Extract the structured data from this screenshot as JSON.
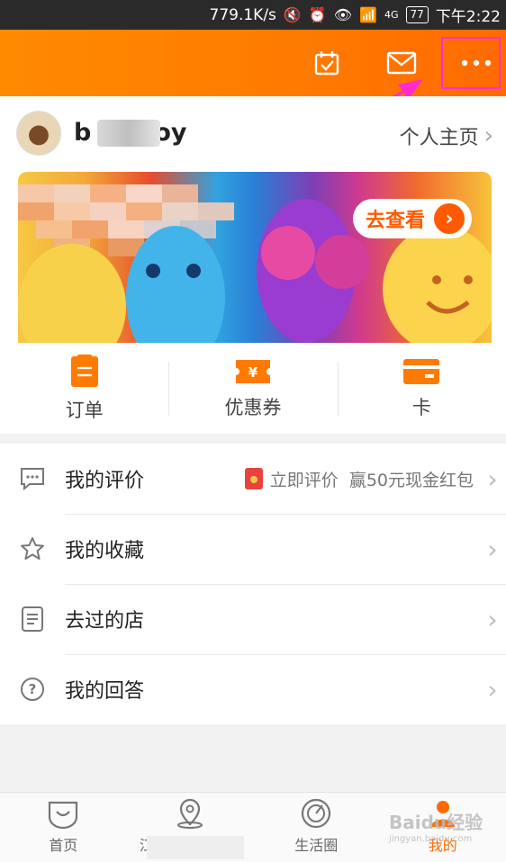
{
  "status_bar": {
    "speed": "779.1K/s",
    "network": "4G",
    "battery": "77",
    "time": "下午2:22"
  },
  "top_bar": {
    "icons": [
      "calendar-check-icon",
      "mail-icon",
      "more-dots-icon"
    ],
    "accent_color": "#ff7a00",
    "highlight_color": "#ff2bd1"
  },
  "profile": {
    "username_start": "b",
    "username_end": "oy",
    "homepage_label": "个人主页"
  },
  "banner": {
    "cta_label": "去查看"
  },
  "shortcuts": [
    {
      "label": "订单",
      "icon": "order-clipboard-icon"
    },
    {
      "label": "优惠券",
      "icon": "coupon-yen-icon"
    },
    {
      "label": "卡",
      "icon": "card-icon"
    }
  ],
  "menu": [
    {
      "label": "我的评价",
      "icon": "comment-bubble-icon",
      "extra_link": "立即评价",
      "extra_promo": "赢50元现金红包"
    },
    {
      "label": "我的收藏",
      "icon": "star-icon"
    },
    {
      "label": "去过的店",
      "icon": "document-list-icon"
    },
    {
      "label": "我的回答",
      "icon": "question-circle-icon"
    }
  ],
  "tabbar": [
    {
      "label": "首页",
      "icon": "home-smile-icon",
      "active": false
    },
    {
      "label": "江",
      "icon": "location-pin-icon",
      "active": false
    },
    {
      "label": "生活圈",
      "icon": "compass-ring-icon",
      "active": false
    },
    {
      "label": "我的",
      "icon": "profile-icon",
      "active": true
    }
  ],
  "watermark": {
    "text": "Baidu经验",
    "sub": "jingyan.baidu.com"
  }
}
